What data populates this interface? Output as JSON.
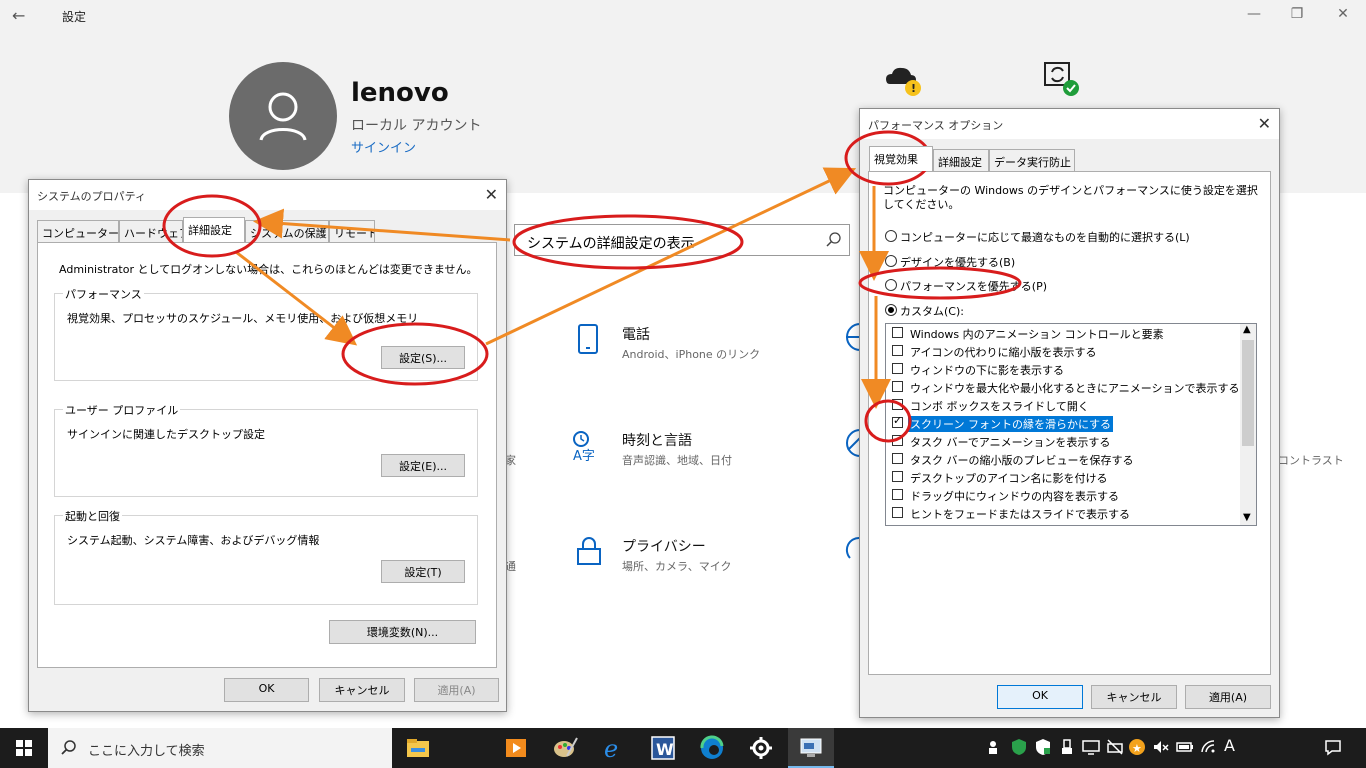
{
  "settings_window": {
    "title": "設定",
    "back": "←",
    "minimize": "—",
    "maximize": "❐",
    "close": "✕",
    "user": {
      "name": "lenovo",
      "account_type": "ローカル アカウント",
      "signin_link": "サインイン"
    },
    "search": {
      "value": "システムの詳細設定の表示"
    },
    "tiles": [
      {
        "title": "電話",
        "subtitle": "Android、iPhone のリンク"
      },
      {
        "title": "時刻と言語",
        "subtitle": "音声認識、地域、日付"
      },
      {
        "title": "プライバシー",
        "subtitle": "場所、カメラ、マイク"
      }
    ],
    "partial_texts": [
      "家",
      "通",
      "コントラスト"
    ]
  },
  "system_properties": {
    "title": "システムのプロパティ",
    "tabs": [
      "コンピューター名",
      "ハードウェア",
      "詳細設定",
      "システムの保護",
      "リモート"
    ],
    "active_tab": "詳細設定",
    "admin_note": "Administrator としてログオンしない場合は、これらのほとんどは変更できません。",
    "groups": [
      {
        "label": "パフォーマンス",
        "desc": "視覚効果、プロセッサのスケジュール、メモリ使用、および仮想メモリ",
        "button": "設定(S)..."
      },
      {
        "label": "ユーザー プロファイル",
        "desc": "サインインに関連したデスクトップ設定",
        "button": "設定(E)..."
      },
      {
        "label": "起動と回復",
        "desc": "システム起動、システム障害、およびデバッグ情報",
        "button": "設定(T)"
      }
    ],
    "env_button": "環境変数(N)...",
    "ok": "OK",
    "cancel": "キャンセル",
    "apply": "適用(A)"
  },
  "performance_options": {
    "title": "パフォーマンス オプション",
    "tabs": [
      "視覚効果",
      "詳細設定",
      "データ実行防止"
    ],
    "active_tab": "視覚効果",
    "intro": "コンピューターの Windows のデザインとパフォーマンスに使う設定を選択してください。",
    "radios": [
      {
        "label": "コンピューターに応じて最適なものを自動的に選択する(L)",
        "selected": false
      },
      {
        "label": "デザインを優先する(B)",
        "selected": false
      },
      {
        "label": "パフォーマンスを優先する(P)",
        "selected": false
      },
      {
        "label": "カスタム(C):",
        "selected": true
      }
    ],
    "options": [
      {
        "label": "Windows 内のアニメーション コントロールと要素",
        "checked": false,
        "highlighted": false
      },
      {
        "label": "アイコンの代わりに縮小版を表示する",
        "checked": false,
        "highlighted": false
      },
      {
        "label": "ウィンドウの下に影を表示する",
        "checked": false,
        "highlighted": false
      },
      {
        "label": "ウィンドウを最大化や最小化するときにアニメーションで表示する",
        "checked": false,
        "highlighted": false
      },
      {
        "label": "コンボ ボックスをスライドして開く",
        "checked": false,
        "highlighted": false
      },
      {
        "label": "スクリーン フォントの縁を滑らかにする",
        "checked": true,
        "highlighted": true
      },
      {
        "label": "タスク バーでアニメーションを表示する",
        "checked": false,
        "highlighted": false
      },
      {
        "label": "タスク バーの縮小版のプレビューを保存する",
        "checked": false,
        "highlighted": false
      },
      {
        "label": "デスクトップのアイコン名に影を付ける",
        "checked": false,
        "highlighted": false
      },
      {
        "label": "ドラッグ中にウィンドウの内容を表示する",
        "checked": false,
        "highlighted": false
      },
      {
        "label": "ヒントをフェードまたはスライドで表示する",
        "checked": false,
        "highlighted": false
      }
    ],
    "ok": "OK",
    "cancel": "キャンセル",
    "apply": "適用(A)"
  },
  "taskbar": {
    "search_placeholder": "ここに入力して検索",
    "ime_indicator": "A",
    "apps": [
      "file-explorer",
      "media-player",
      "paint",
      "internet-explorer",
      "word",
      "edge",
      "settings",
      "system-properties"
    ]
  },
  "colors": {
    "accent": "#0078d7",
    "annotation_red": "#d81c1c",
    "annotation_orange": "#f08a24"
  }
}
